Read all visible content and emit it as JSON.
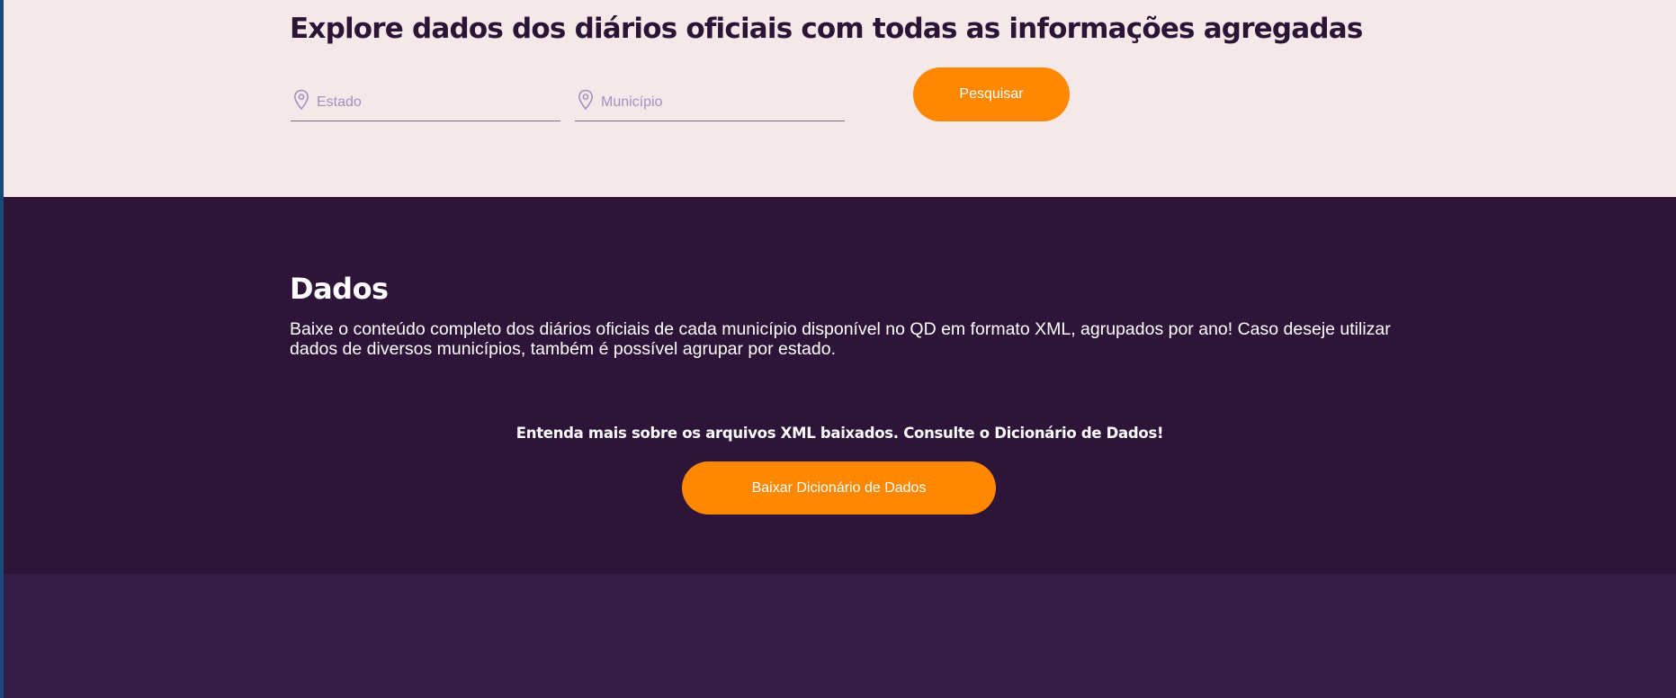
{
  "hero": {
    "title": "Explore dados dos diários oficiais com todas as informações agregadas",
    "estado_placeholder": "Estado",
    "municipio_placeholder": "Município",
    "search_button": "Pesquisar"
  },
  "dados": {
    "title": "Dados",
    "description": "Baixe o conteúdo completo dos diários oficiais de cada município disponível no QD em formato XML, agrupados por ano! Caso deseje utilizar dados de diversos municípios, também é possível agrupar por estado.",
    "dictionary_note": "Entenda mais sobre os arquivos XML baixados. Consulte o Dicionário de Dados!",
    "dictionary_button": "Baixar Dicionário de Dados"
  },
  "colors": {
    "hero_background": "#f4e9e8",
    "dark_section": "#2d1438",
    "bottom_section": "#351c44",
    "accent_orange": "#ff8800",
    "title_text": "#2c1437",
    "placeholder_text": "#a68fc0"
  },
  "icons": {
    "estado": "location-pin-icon",
    "municipio": "location-pin-icon"
  }
}
